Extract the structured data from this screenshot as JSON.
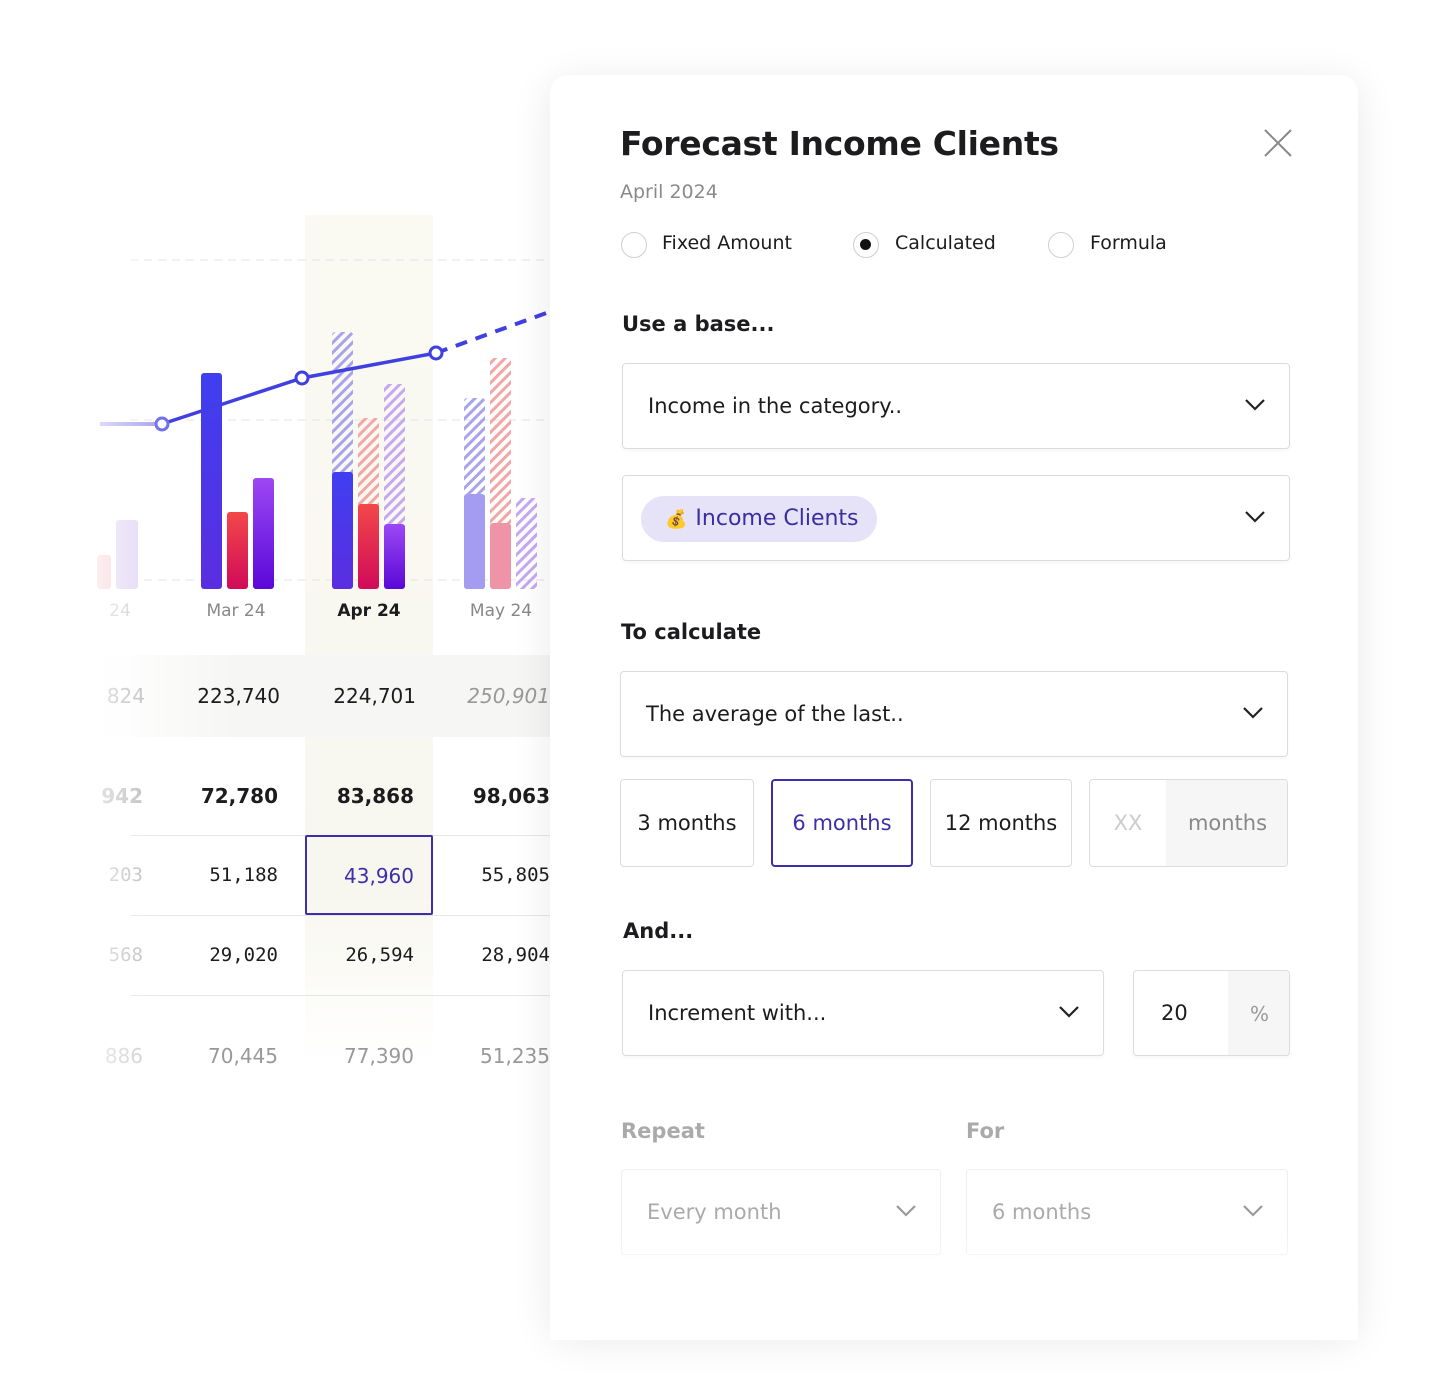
{
  "background": {
    "chart": {
      "x_labels": [
        "24",
        "Mar 24",
        "Apr 24",
        "May 24"
      ],
      "active_label": "Apr 24"
    },
    "table": {
      "rows": [
        [
          "824",
          "223,740",
          "224,701",
          "250,901"
        ],
        [
          "942",
          "72,780",
          "83,868",
          "98,063"
        ],
        [
          "203",
          "51,188",
          "43,960",
          "55,805"
        ],
        [
          "568",
          "29,020",
          "26,594",
          "28,904"
        ],
        [
          "886",
          "70,445",
          "77,390",
          "51,235"
        ]
      ],
      "selected_cell": "43,960"
    }
  },
  "panel": {
    "title": "Forecast Income Clients",
    "subtitle": "April 2024",
    "close_icon": "close-x-icon",
    "mode_options": [
      {
        "label": "Fixed Amount",
        "selected": false
      },
      {
        "label": "Calculated",
        "selected": true
      },
      {
        "label": "Formula",
        "selected": false
      }
    ],
    "base_section": "Use a base...",
    "base_select": "Income in the category..",
    "category_chip": {
      "emoji": "💰",
      "label": "Income Clients"
    },
    "calc_section": "To calculate",
    "calc_select": "The average of the last..",
    "period_options": [
      "3 months",
      "6 months",
      "12 months"
    ],
    "selected_period": "6 months",
    "custom_period": {
      "placeholder": "XX",
      "unit": "months"
    },
    "and_section": "And...",
    "increment_select": "Increment with...",
    "increment_value": "20",
    "increment_unit": "%",
    "repeat_label": "Repeat",
    "repeat_select": "Every month",
    "for_label": "For",
    "for_select": "6 months",
    "accent_color": "#3d2fa8"
  }
}
